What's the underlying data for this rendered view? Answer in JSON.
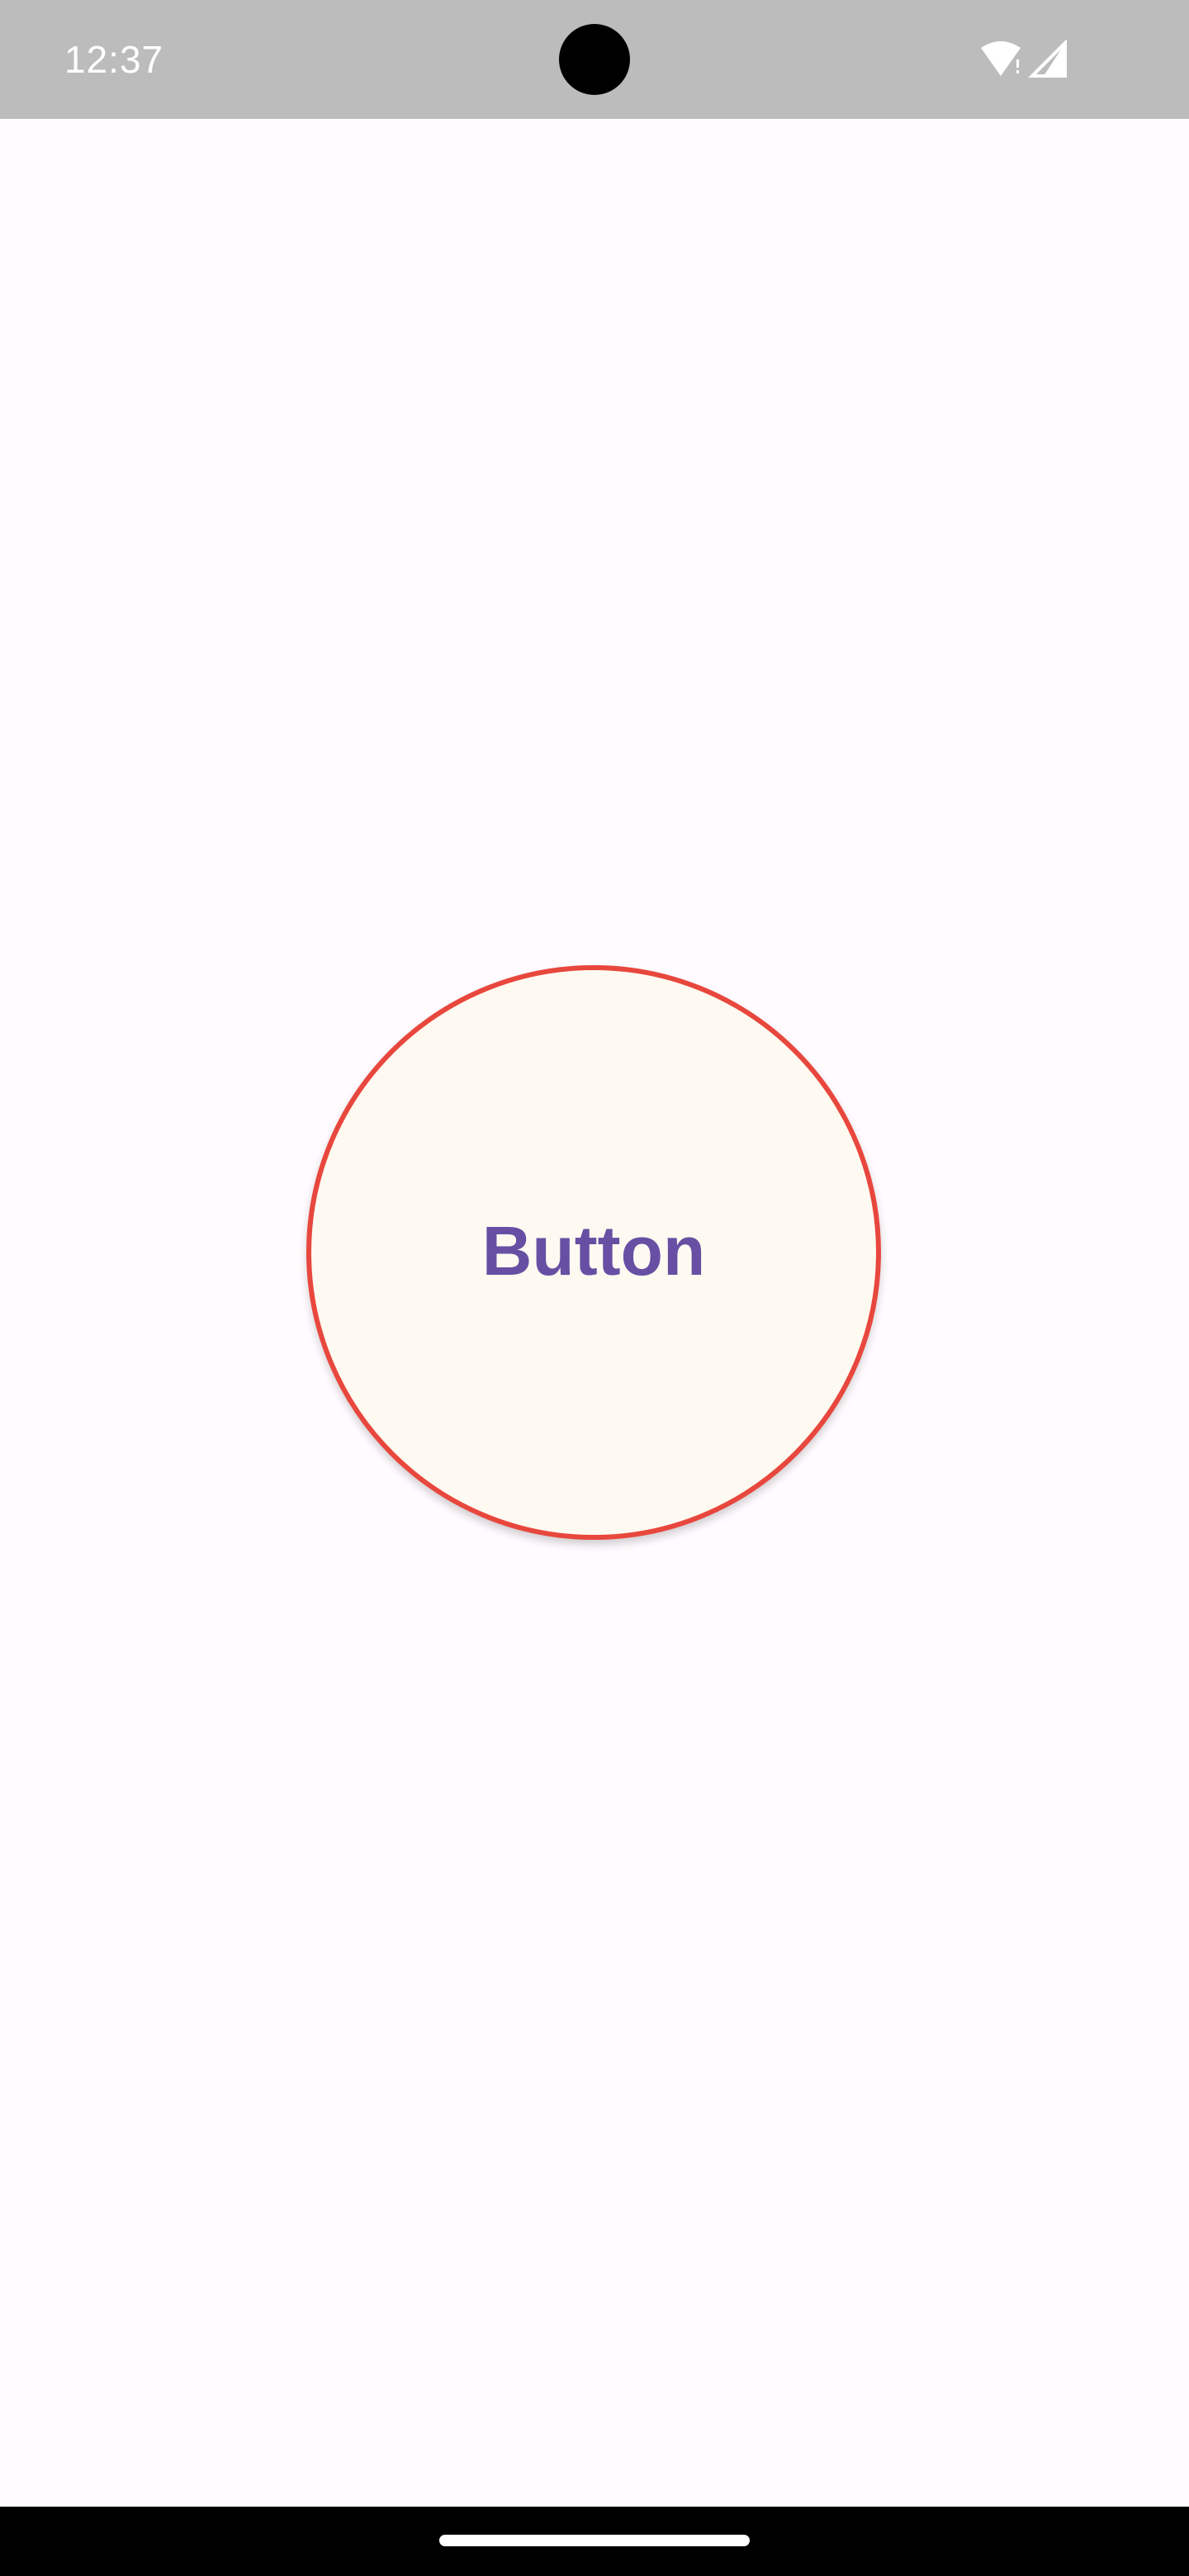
{
  "status_bar": {
    "time": "12:37",
    "icons": [
      "wifi-icon",
      "signal-icon"
    ]
  },
  "main": {
    "button_label": "Button"
  },
  "colors": {
    "status_bar_bg": "#bdbcbc",
    "background": "#fffbfe",
    "button_border": "#e8473d",
    "button_fill": "#fffaf1",
    "button_text": "#6750a4",
    "nav_bar_bg": "#000000"
  }
}
